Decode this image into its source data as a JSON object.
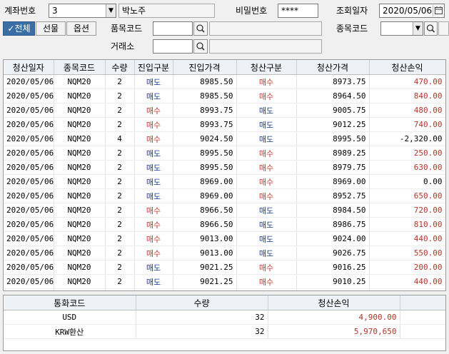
{
  "toolbar": {
    "account_label": "계좌번호",
    "account_value": "3",
    "account_name": "박노주",
    "password_label": "비밀번호",
    "password_value": "****",
    "query_date_label": "조회일자",
    "query_date_value": "2020/05/06",
    "tabs": [
      {
        "label": "전체",
        "checked": true
      },
      {
        "label": "선물"
      },
      {
        "label": "옵션"
      }
    ],
    "product_code_label": "품목코드",
    "item_code_label": "종목코드",
    "exchange_label": "거래소"
  },
  "table": {
    "columns": [
      "청산일자",
      "종목코드",
      "수량",
      "진입구분",
      "진입가격",
      "청산구분",
      "청산가격",
      "청산손익"
    ],
    "rows": [
      [
        "2020/05/06",
        "NQM20",
        "2",
        "매도",
        "8985.50",
        "매수",
        "8973.75",
        "470.00"
      ],
      [
        "2020/05/06",
        "NQM20",
        "2",
        "매도",
        "8985.50",
        "매수",
        "8964.50",
        "840.00"
      ],
      [
        "2020/05/06",
        "NQM20",
        "2",
        "매수",
        "8993.75",
        "매도",
        "9005.75",
        "480.00"
      ],
      [
        "2020/05/06",
        "NQM20",
        "2",
        "매수",
        "8993.75",
        "매도",
        "9012.25",
        "740.00"
      ],
      [
        "2020/05/06",
        "NQM20",
        "4",
        "매수",
        "9024.50",
        "매도",
        "8995.50",
        "-2,320.00"
      ],
      [
        "2020/05/06",
        "NQM20",
        "2",
        "매도",
        "8995.50",
        "매수",
        "8989.25",
        "250.00"
      ],
      [
        "2020/05/06",
        "NQM20",
        "2",
        "매도",
        "8995.50",
        "매수",
        "8979.75",
        "630.00"
      ],
      [
        "2020/05/06",
        "NQM20",
        "2",
        "매도",
        "8969.00",
        "매수",
        "8969.00",
        "0.00"
      ],
      [
        "2020/05/06",
        "NQM20",
        "2",
        "매도",
        "8969.00",
        "매수",
        "8952.75",
        "650.00"
      ],
      [
        "2020/05/06",
        "NQM20",
        "2",
        "매수",
        "8966.50",
        "매도",
        "8984.50",
        "720.00"
      ],
      [
        "2020/05/06",
        "NQM20",
        "2",
        "매수",
        "8966.50",
        "매도",
        "8986.75",
        "810.00"
      ],
      [
        "2020/05/06",
        "NQM20",
        "2",
        "매수",
        "9013.00",
        "매도",
        "9024.00",
        "440.00"
      ],
      [
        "2020/05/06",
        "NQM20",
        "2",
        "매수",
        "9013.00",
        "매도",
        "9026.75",
        "550.00"
      ],
      [
        "2020/05/06",
        "NQM20",
        "2",
        "매도",
        "9021.25",
        "매수",
        "9016.25",
        "200.00"
      ],
      [
        "2020/05/06",
        "NQM20",
        "2",
        "매도",
        "9021.25",
        "매수",
        "9010.25",
        "440.00"
      ]
    ]
  },
  "summary": {
    "columns": [
      "통화코드",
      "수량",
      "청산손익"
    ],
    "rows": [
      [
        "USD",
        "32",
        "4,900.00"
      ],
      [
        "KRW환산",
        "32",
        "5,970,650"
      ]
    ]
  },
  "colors": {
    "buy": "#c0392b",
    "sell": "#1c3c8c",
    "positive_pnl": "#b1362a",
    "tab_active": "#3b6ea5"
  }
}
